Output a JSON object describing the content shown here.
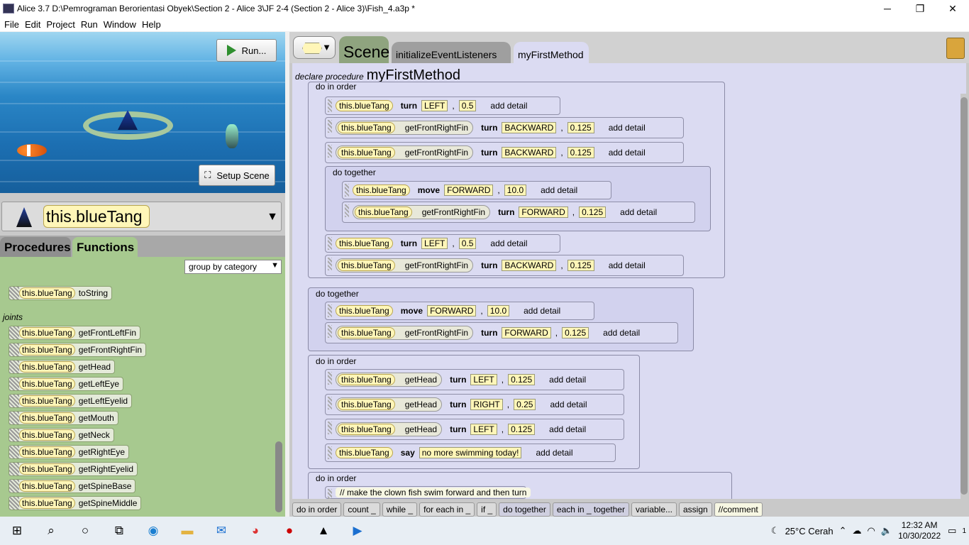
{
  "window": {
    "title": "Alice 3.7 D:\\Pemrograman Berorientasi Obyek\\Section 2 - Alice 3\\JF 2-4 (Section 2 - Alice 3)\\Fish_4.a3p *",
    "controls": [
      "─",
      "❐",
      "✕"
    ]
  },
  "menu": [
    "File",
    "Edit",
    "Project",
    "Run",
    "Window",
    "Help"
  ],
  "scene": {
    "run_label": "Run...",
    "setup_label": "Setup Scene"
  },
  "selector": {
    "object": "this.blueTang"
  },
  "left_tabs": {
    "procedures": "Procedures",
    "functions": "Functions"
  },
  "functions": {
    "group_by": "group by category",
    "partial_tostring": {
      "receiver": "this.blueTang",
      "name": "toString"
    },
    "joints_label": "joints",
    "items": [
      {
        "receiver": "this.blueTang",
        "name": "getFrontLeftFin"
      },
      {
        "receiver": "this.blueTang",
        "name": "getFrontRightFin"
      },
      {
        "receiver": "this.blueTang",
        "name": "getHead"
      },
      {
        "receiver": "this.blueTang",
        "name": "getLeftEye"
      },
      {
        "receiver": "this.blueTang",
        "name": "getLeftEyelid"
      },
      {
        "receiver": "this.blueTang",
        "name": "getMouth"
      },
      {
        "receiver": "this.blueTang",
        "name": "getNeck"
      },
      {
        "receiver": "this.blueTang",
        "name": "getRightEye"
      },
      {
        "receiver": "this.blueTang",
        "name": "getRightEyelid"
      },
      {
        "receiver": "this.blueTang",
        "name": "getSpineBase"
      },
      {
        "receiver": "this.blueTang",
        "name": "getSpineMiddle"
      }
    ]
  },
  "editor_tabs": {
    "scene": "Scene",
    "init": "initializeEventListeners",
    "method": "myFirstMethod"
  },
  "method": {
    "declare": "declare procedure",
    "name": "myFirstMethod"
  },
  "code": {
    "do_in_order": "do in order",
    "do_together": "do together",
    "add_detail": "add detail",
    "receiver": "this.blueTang",
    "s1": {
      "proc": "turn",
      "dir": "LEFT",
      "amt": "0.5"
    },
    "s2": {
      "fn": "getFrontRightFin",
      "proc": "turn",
      "dir": "BACKWARD",
      "amt": "0.125"
    },
    "s3": {
      "fn": "getFrontRightFin",
      "proc": "turn",
      "dir": "BACKWARD",
      "amt": "0.125"
    },
    "s4": {
      "proc": "move",
      "dir": "FORWARD",
      "amt": "10.0"
    },
    "s5": {
      "fn": "getFrontRightFin",
      "proc": "turn",
      "dir": "FORWARD",
      "amt": "0.125"
    },
    "s6": {
      "proc": "turn",
      "dir": "LEFT",
      "amt": "0.5"
    },
    "s7": {
      "fn": "getFrontRightFin",
      "proc": "turn",
      "dir": "BACKWARD",
      "amt": "0.125"
    },
    "s8": {
      "proc": "move",
      "dir": "FORWARD",
      "amt": "10.0"
    },
    "s9": {
      "fn": "getFrontRightFin",
      "proc": "turn",
      "dir": "FORWARD",
      "amt": "0.125"
    },
    "s10": {
      "fn": "getHead",
      "proc": "turn",
      "dir": "LEFT",
      "amt": "0.125"
    },
    "s11": {
      "fn": "getHead",
      "proc": "turn",
      "dir": "RIGHT",
      "amt": "0.25"
    },
    "s12": {
      "fn": "getHead",
      "proc": "turn",
      "dir": "LEFT",
      "amt": "0.125"
    },
    "s13": {
      "proc": "say",
      "text": "no more swimming today!"
    },
    "comment": "// make the clown fish swim forward and then turn"
  },
  "palette": [
    "do in order",
    "count _",
    "while _",
    "for each in _",
    "if _",
    "do together",
    "each in _ together",
    "variable...",
    "assign",
    "//comment"
  ],
  "taskbar": {
    "weather": "25°C  Cerah",
    "time": "12:32 AM",
    "date": "10/30/2022",
    "notif": "1"
  }
}
